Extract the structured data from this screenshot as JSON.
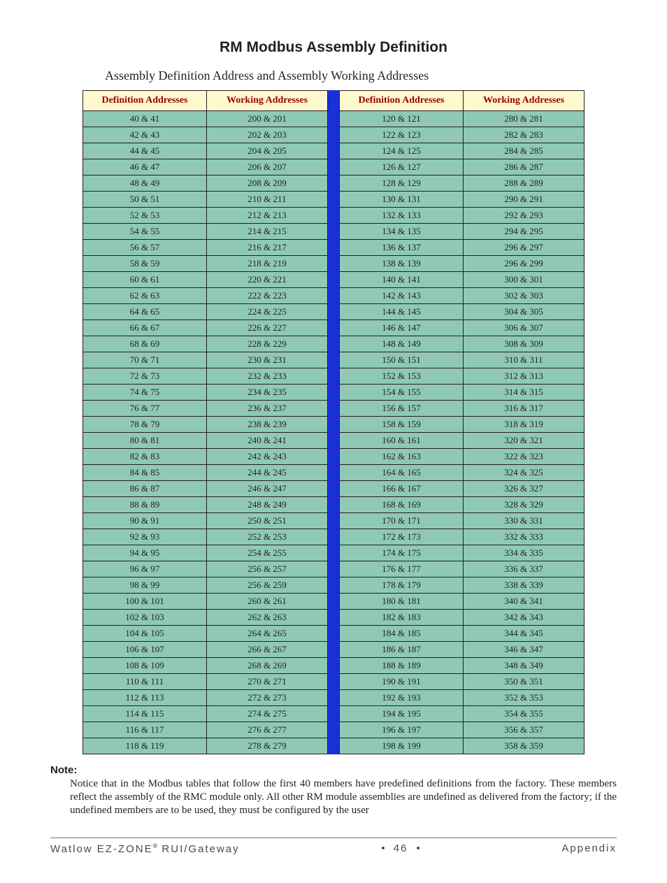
{
  "title": "RM Modbus Assembly Definition",
  "subtitle": "Assembly Definition Address and Assembly Working Addresses",
  "headers": {
    "def": "Definition Addresses",
    "work": "Working Addresses"
  },
  "left_rows": [
    {
      "d": "40 & 41",
      "w": "200 & 201"
    },
    {
      "d": "42 & 43",
      "w": "202 & 203"
    },
    {
      "d": "44 & 45",
      "w": "204 & 205"
    },
    {
      "d": "46 & 47",
      "w": "206 & 207"
    },
    {
      "d": "48 & 49",
      "w": "208 & 209"
    },
    {
      "d": "50 & 51",
      "w": "210 & 211"
    },
    {
      "d": "52 & 53",
      "w": "212 & 213"
    },
    {
      "d": "54 & 55",
      "w": "214 & 215"
    },
    {
      "d": "56 & 57",
      "w": "216 & 217"
    },
    {
      "d": "58 & 59",
      "w": "218 & 219"
    },
    {
      "d": "60 & 61",
      "w": "220 & 221"
    },
    {
      "d": "62 & 63",
      "w": "222 & 223"
    },
    {
      "d": "64 & 65",
      "w": "224 & 225"
    },
    {
      "d": "66 & 67",
      "w": "226 & 227"
    },
    {
      "d": "68 & 69",
      "w": "228 & 229"
    },
    {
      "d": "70 & 71",
      "w": "230 & 231"
    },
    {
      "d": "72 & 73",
      "w": "232 & 233"
    },
    {
      "d": "74 & 75",
      "w": "234 & 235"
    },
    {
      "d": "76 & 77",
      "w": "236 & 237"
    },
    {
      "d": "78 & 79",
      "w": "238 & 239"
    },
    {
      "d": "80 & 81",
      "w": "240 & 241"
    },
    {
      "d": "82 & 83",
      "w": "242 & 243"
    },
    {
      "d": "84 & 85",
      "w": "244 & 245"
    },
    {
      "d": "86 & 87",
      "w": "246 & 247"
    },
    {
      "d": "88 & 89",
      "w": "248 & 249"
    },
    {
      "d": "90 & 91",
      "w": "250 & 251"
    },
    {
      "d": "92 & 93",
      "w": "252 & 253"
    },
    {
      "d": "94 & 95",
      "w": "254 & 255"
    },
    {
      "d": "96 & 97",
      "w": "256 & 257"
    },
    {
      "d": "98 & 99",
      "w": "256 & 259"
    },
    {
      "d": "100 & 101",
      "w": "260 & 261"
    },
    {
      "d": "102 & 103",
      "w": "262 & 263"
    },
    {
      "d": "104 & 105",
      "w": "264 & 265"
    },
    {
      "d": "106 & 107",
      "w": "266 & 267"
    },
    {
      "d": "108 & 109",
      "w": "268 & 269"
    },
    {
      "d": "110 & 111",
      "w": "270 & 271"
    },
    {
      "d": "112 & 113",
      "w": "272 & 273"
    },
    {
      "d": "114 & 115",
      "w": "274 & 275"
    },
    {
      "d": "116 & 117",
      "w": "276 & 277"
    },
    {
      "d": "118 & 119",
      "w": "278 & 279"
    }
  ],
  "right_rows": [
    {
      "d": "120 & 121",
      "w": "280 & 281"
    },
    {
      "d": "122 & 123",
      "w": "282 & 283"
    },
    {
      "d": "124 & 125",
      "w": "284 & 285"
    },
    {
      "d": "126 & 127",
      "w": "286 & 287"
    },
    {
      "d": "128 & 129",
      "w": "288 & 289"
    },
    {
      "d": "130 & 131",
      "w": "290 & 291"
    },
    {
      "d": "132 & 133",
      "w": "292 & 293"
    },
    {
      "d": "134 & 135",
      "w": "294 & 295"
    },
    {
      "d": "136 & 137",
      "w": "296 & 297"
    },
    {
      "d": "138 & 139",
      "w": "296 & 299"
    },
    {
      "d": "140 & 141",
      "w": "300 & 301"
    },
    {
      "d": "142 & 143",
      "w": "302 & 303"
    },
    {
      "d": "144 & 145",
      "w": "304 & 305"
    },
    {
      "d": "146 & 147",
      "w": "306 & 307"
    },
    {
      "d": "148 & 149",
      "w": "308 & 309"
    },
    {
      "d": "150 & 151",
      "w": "310 & 311"
    },
    {
      "d": "152 & 153",
      "w": "312 & 313"
    },
    {
      "d": "154 & 155",
      "w": "314 & 315"
    },
    {
      "d": "156 & 157",
      "w": "316 & 317"
    },
    {
      "d": "158 & 159",
      "w": "318 & 319"
    },
    {
      "d": "160 & 161",
      "w": "320 & 321"
    },
    {
      "d": "162 & 163",
      "w": "322 & 323"
    },
    {
      "d": "164 & 165",
      "w": "324 & 325"
    },
    {
      "d": "166 & 167",
      "w": "326 & 327"
    },
    {
      "d": "168 & 169",
      "w": "328 & 329"
    },
    {
      "d": "170 & 171",
      "w": "330 & 331"
    },
    {
      "d": "172 & 173",
      "w": "332 & 333"
    },
    {
      "d": "174 & 175",
      "w": "334 & 335"
    },
    {
      "d": "176 & 177",
      "w": "336 & 337"
    },
    {
      "d": "178 & 179",
      "w": "338 & 339"
    },
    {
      "d": "180 & 181",
      "w": "340 & 341"
    },
    {
      "d": "182 & 183",
      "w": "342 & 343"
    },
    {
      "d": "184 & 185",
      "w": "344 & 345"
    },
    {
      "d": "186 & 187",
      "w": "346 & 347"
    },
    {
      "d": "188 & 189",
      "w": "348 & 349"
    },
    {
      "d": "190 & 191",
      "w": "350 & 351"
    },
    {
      "d": "192 & 193",
      "w": "352 & 353"
    },
    {
      "d": "194 & 195",
      "w": "354 & 355"
    },
    {
      "d": "196 & 197",
      "w": "356 & 357"
    },
    {
      "d": "198 & 199",
      "w": "358 & 359"
    }
  ],
  "note_heading": "Note:",
  "note_body": "Notice that in the Modbus tables that follow the first 40 members have predefined definitions from the factory. These members reflect the assembly of the RMC module only. All other RM module assemblies are undefined as delivered from the factory; if the undefined members are to be used, they must be configured by the user",
  "footer": {
    "left_prefix": "Watlow EZ-ZONE",
    "left_reg": "®",
    "left_suffix": " RUI/Gateway",
    "bullet": "•",
    "page": "46",
    "right": "Appendix"
  }
}
